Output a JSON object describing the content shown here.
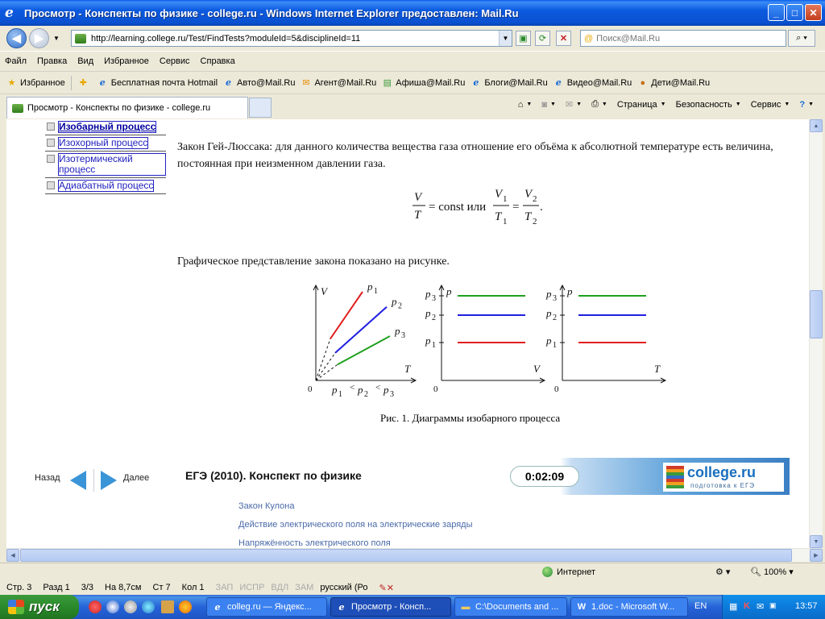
{
  "window": {
    "title": "Просмотр - Конспекты по физике - college.ru - Windows Internet Explorer предоставлен: Mail.Ru",
    "buttons": {
      "minimize": "_",
      "maximize": "□",
      "close": "✕"
    }
  },
  "address_bar": {
    "url": "http://learning.college.ru/Test/FindTests?moduleId=5&disciplineId=11",
    "search_placeholder": "Поиск@Mail.Ru"
  },
  "menu": [
    "Файл",
    "Правка",
    "Вид",
    "Избранное",
    "Сервис",
    "Справка"
  ],
  "favorites": {
    "label": "Избранное",
    "items": [
      "Бесплатная почта Hotmail",
      "Авто@Mail.Ru",
      "Агент@Mail.Ru",
      "Афиша@Mail.Ru",
      "Блоги@Mail.Ru",
      "Видео@Mail.Ru",
      "Дети@Mail.Ru"
    ]
  },
  "tab": {
    "title": "Просмотр - Конспекты по физике - college.ru"
  },
  "command_bar": {
    "page": "Страница",
    "safety": "Безопасность",
    "tools": "Сервис"
  },
  "left_nav": [
    {
      "label": "Изобарный процесс",
      "active": true
    },
    {
      "label": "Изохорный процесс",
      "active": false
    },
    {
      "label": "Изотермический процесс",
      "active": false
    },
    {
      "label": "Адиабатный процесс",
      "active": false
    }
  ],
  "article": {
    "law_text": "Закон Гей-Люссака: для данного количества вещества газа отношение его объёма к абсолютной температуре есть величина, постоянная при неизменном давлении газа.",
    "formula_const": "= const или",
    "graph_text": "Графическое представление закона показано на рисунке.",
    "caption": "Рис. 1. Диаграммы изобарного процесса"
  },
  "chart_data": [
    {
      "type": "line",
      "title": "",
      "xlabel": "T",
      "ylabel": "V",
      "origin_label": "0",
      "x_condition": "p1 < p2 < p3",
      "series": [
        {
          "name": "p1",
          "color": "#e02020",
          "points": [
            [
              0.18,
              0.47
            ],
            [
              0.58,
              1.0
            ]
          ]
        },
        {
          "name": "p2",
          "color": "#2020e0",
          "points": [
            [
              0.24,
              0.31
            ],
            [
              0.88,
              0.83
            ]
          ]
        },
        {
          "name": "p3",
          "color": "#20a020",
          "points": [
            [
              0.27,
              0.18
            ],
            [
              0.92,
              0.5
            ]
          ]
        }
      ]
    },
    {
      "type": "line",
      "title": "",
      "xlabel": "V",
      "ylabel": "p",
      "origin_label": "0",
      "series": [
        {
          "name": "p3",
          "color": "#20a020",
          "level": 3
        },
        {
          "name": "p2",
          "color": "#2020e0",
          "level": 2
        },
        {
          "name": "p1",
          "color": "#e02020",
          "level": 1
        }
      ]
    },
    {
      "type": "line",
      "title": "",
      "xlabel": "T",
      "ylabel": "p",
      "origin_label": "0",
      "series": [
        {
          "name": "p3",
          "color": "#20a020",
          "level": 3
        },
        {
          "name": "p2",
          "color": "#2020e0",
          "level": 2
        },
        {
          "name": "p1",
          "color": "#e02020",
          "level": 1
        }
      ]
    }
  ],
  "course_nav": {
    "back": "Назад",
    "next": "Далее",
    "course_title": "ЕГЭ (2010). Конспект по физике",
    "timer": "0:02:09",
    "logo_brand": "college.ru",
    "logo_tagline": "подготовка к ЕГЭ"
  },
  "topic_links": [
    "Закон Кулона",
    "Действие электрического поля на электрические заряды",
    "Напряжённость электрического поля"
  ],
  "status_bar": {
    "zone": "Интернет",
    "zoom": "100%"
  },
  "word_status": {
    "page": "Стр. 3",
    "section": "Разд 1",
    "pages": "3/3",
    "at": "На 8,7см",
    "line": "Ст 7",
    "column": "Кол 1",
    "flags": [
      "ЗАП",
      "ИСПР",
      "ВДЛ",
      "ЗАМ"
    ],
    "language": "русский (Ро"
  },
  "taskbar": {
    "start": "пуск",
    "tasks": [
      {
        "label": "colleg.ru — Яндекс...",
        "active": false
      },
      {
        "label": "Просмотр - Консп...",
        "active": true
      },
      {
        "label": "C:\\Documents and ...",
        "active": false
      },
      {
        "label": "1.doc - Microsoft W...",
        "active": false
      }
    ],
    "language": "EN",
    "clock": "13:57"
  }
}
